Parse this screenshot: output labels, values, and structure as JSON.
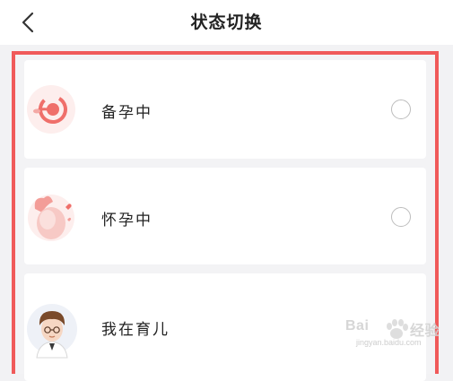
{
  "header": {
    "title": "状态切换",
    "back_icon": "chevron-left-icon"
  },
  "options": [
    {
      "label": "备孕中",
      "icon": "preparing-pregnancy-icon",
      "selected": false
    },
    {
      "label": "怀孕中",
      "icon": "pregnant-icon",
      "selected": false
    },
    {
      "label": "我在育儿",
      "icon": "parenting-avatar-icon",
      "selected": false
    }
  ],
  "watermark": {
    "brand": "Bai",
    "brand_suffix": "经验",
    "domain": "jingyan.baidu.com"
  },
  "colors": {
    "highlight_border": "#f05a5a",
    "radio_border": "#bdbdbd",
    "background": "#f3f3f5",
    "icon_accent": "#ef6f6a"
  }
}
